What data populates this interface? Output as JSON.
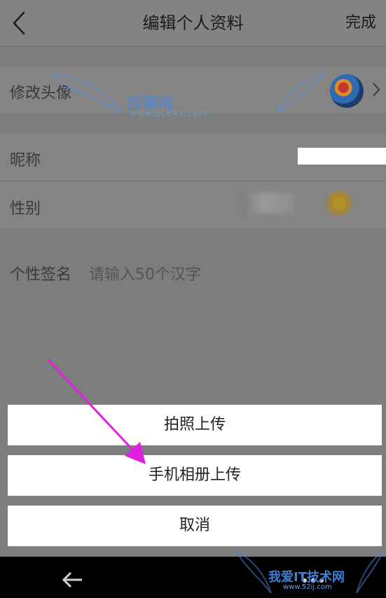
{
  "header": {
    "title": "编辑个人资料",
    "done_label": "完成"
  },
  "rows": {
    "avatar_label": "修改头像",
    "nickname_label": "昵称",
    "gender_label": "性别",
    "signature_label": "个性签名",
    "signature_placeholder": "请输入50个汉字"
  },
  "action_sheet": {
    "take_photo": "拍照上传",
    "album_upload": "手机相册上传",
    "cancel": "取消"
  },
  "watermarks": {
    "top_text": "百事网",
    "top_url": "www.pc841.com",
    "bottom_text": "我爱IT技术网",
    "bottom_url": "www.52ij.com"
  },
  "colors": {
    "overlay": "#7d7d7d",
    "sheet_button": "#ffffff",
    "arrow": "#e020e0",
    "navbar": "#000000"
  },
  "icons": [
    "back-icon",
    "chevron-right-icon",
    "nav-back-icon"
  ]
}
